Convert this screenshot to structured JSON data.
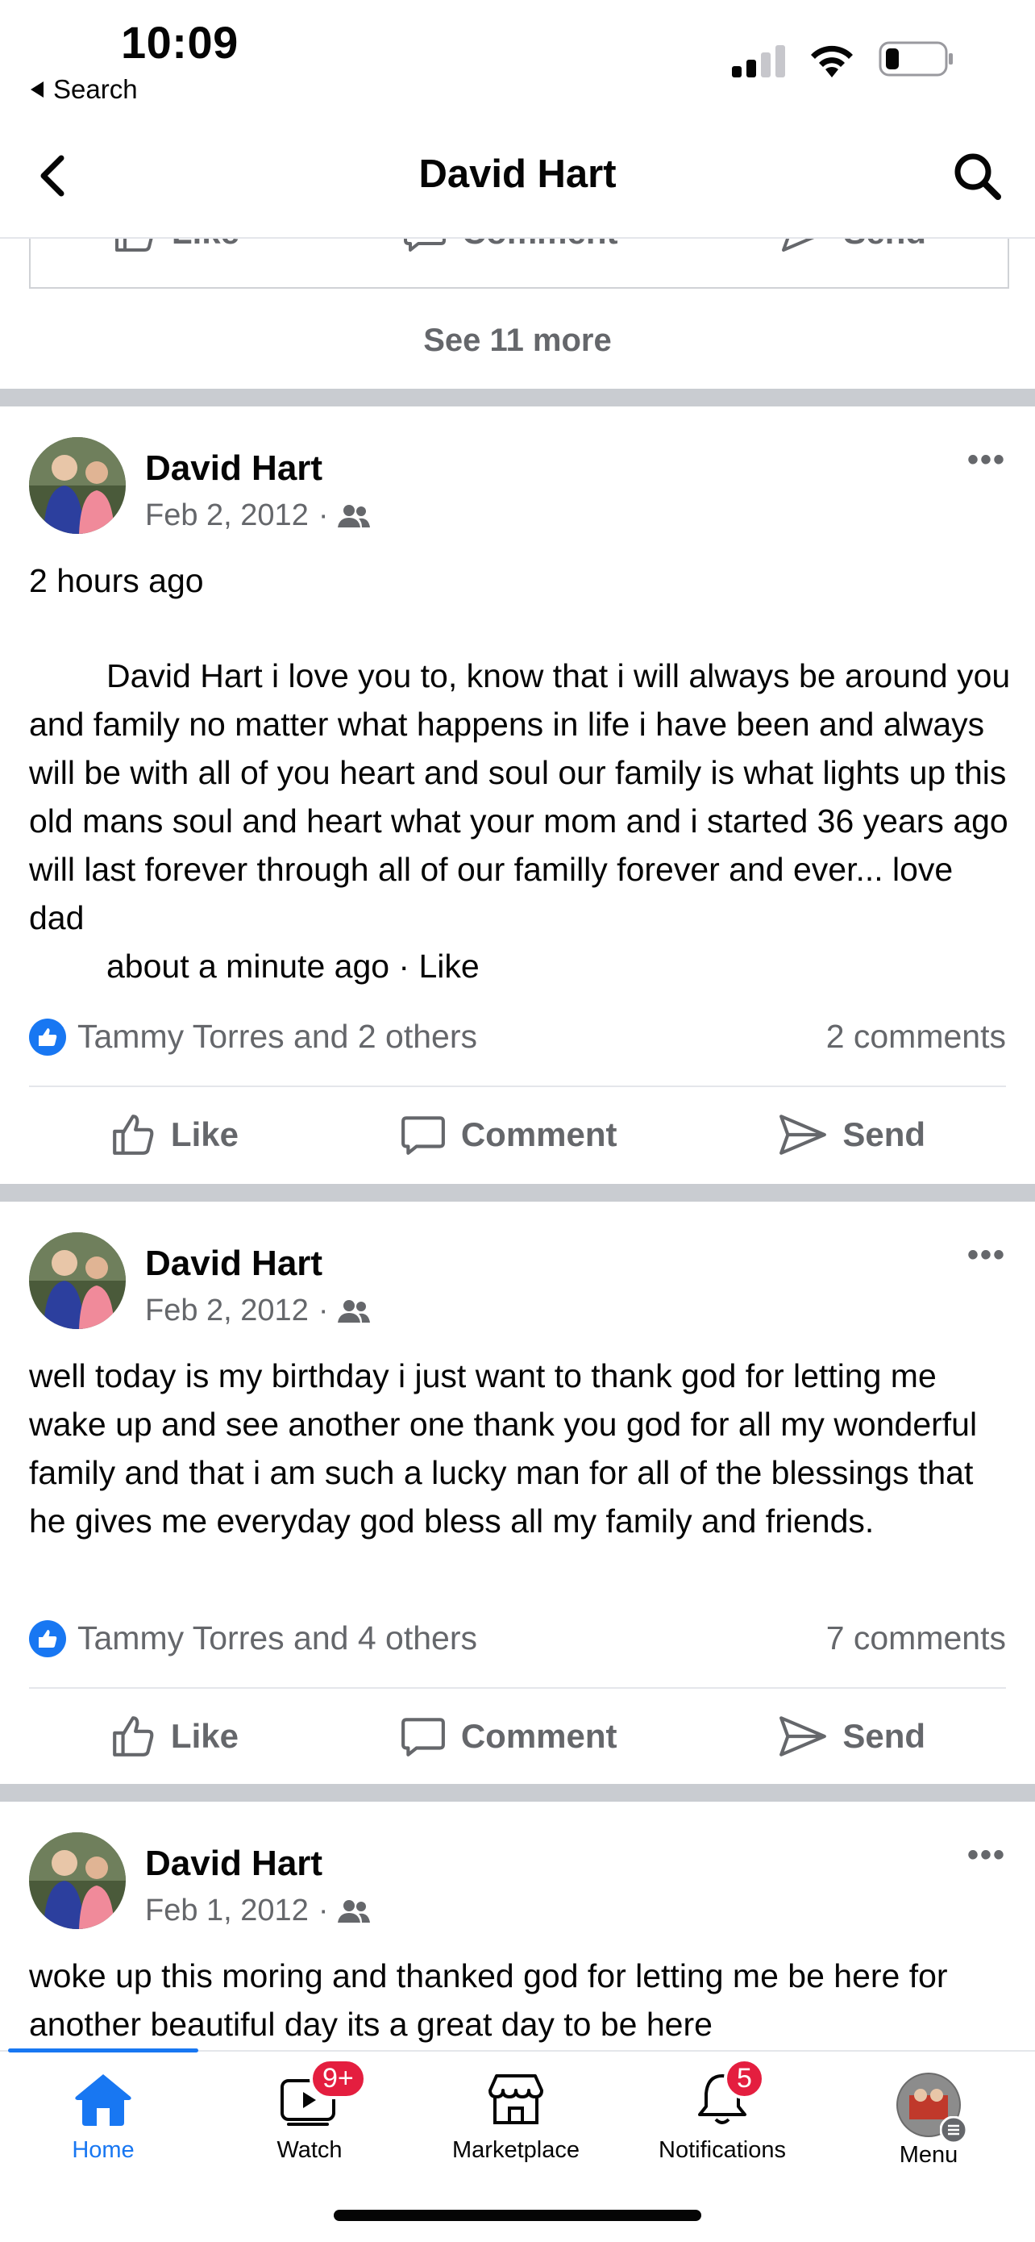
{
  "status": {
    "time": "10:09",
    "back_app": "Search"
  },
  "nav": {
    "title": "David Hart"
  },
  "prev_post": {
    "like": "Like",
    "comment": "Comment",
    "send": "Send",
    "see_more": "See 11 more"
  },
  "posts": [
    {
      "author": "David Hart",
      "date": "Feb 2, 2012",
      "text_line1": "2 hours ago",
      "text_body": "David Hart i love you to, know that i will always be around you and family no matter what happens in life i have been and always will be with all of you heart and soul our family is what lights up this old mans soul and heart what your mom and i started 36 years ago will last forever through all of our familly forever and ever... love dad",
      "text_footer": "about a minute ago · Like",
      "reactions": "Tammy Torres and 2 others",
      "comments": "2 comments",
      "like": "Like",
      "comment": "Comment",
      "send": "Send"
    },
    {
      "author": "David Hart",
      "date": "Feb 2, 2012",
      "text": "well today is my birthday i just want to thank god for letting me wake up and see another one thank you god for all my wonderful family and that i am such a lucky man for all of the blessings that he gives me everyday god bless all my family and friends.",
      "reactions": "Tammy Torres and 4 others",
      "comments": "7 comments",
      "like": "Like",
      "comment": "Comment",
      "send": "Send"
    },
    {
      "author": "David Hart",
      "date": "Feb 1, 2012",
      "text": "woke up this moring and thanked god for letting me be here for another beautiful day its a great day to be here"
    }
  ],
  "tabs": [
    {
      "label": "Home",
      "icon": "home-icon"
    },
    {
      "label": "Watch",
      "icon": "watch-icon",
      "badge": "9+"
    },
    {
      "label": "Marketplace",
      "icon": "marketplace-icon"
    },
    {
      "label": "Notifications",
      "icon": "bell-icon",
      "badge": "5"
    },
    {
      "label": "Menu",
      "icon": "avatar"
    }
  ],
  "colors": {
    "accent": "#1877f2",
    "badge": "#e41e3f",
    "secondary_text": "#65676b"
  }
}
